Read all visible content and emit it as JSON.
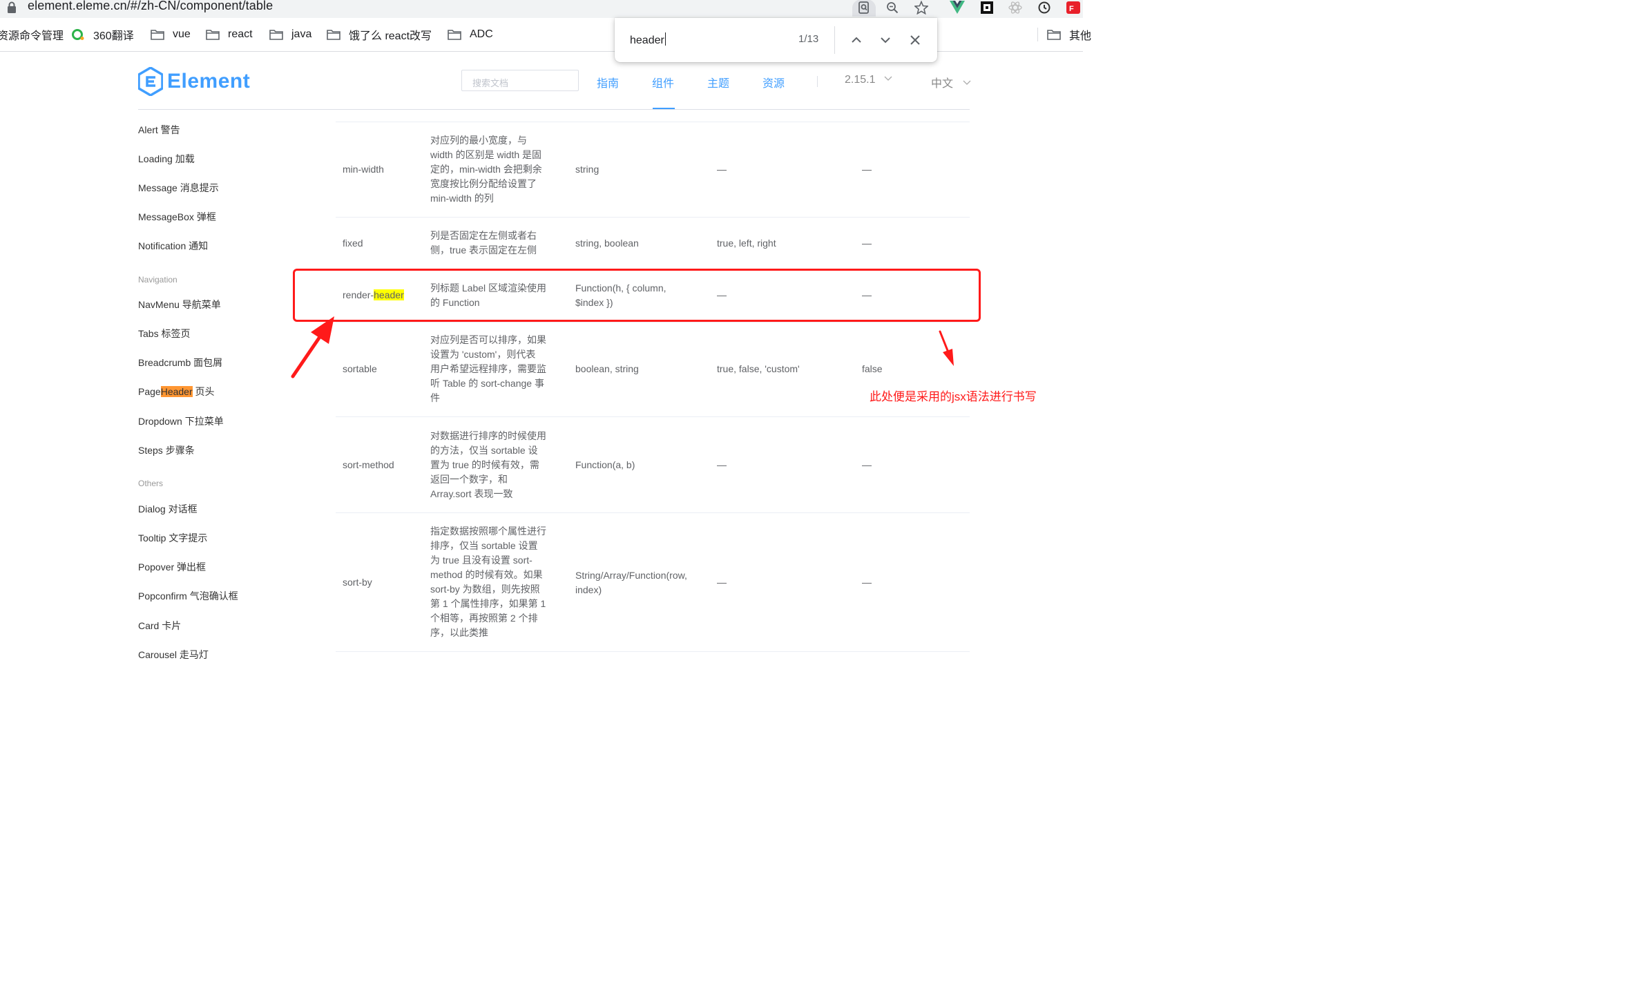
{
  "browser": {
    "url": "element.eleme.cn/#/zh-CN/component/table",
    "bookmarks": [
      "资源命令管理",
      "360翻译",
      "vue",
      "react",
      "java",
      "饿了么 react改写",
      "ADC",
      "其他"
    ],
    "find": {
      "query": "header",
      "count": "1/13"
    }
  },
  "site": {
    "logo": "Element",
    "search_placeholder": "搜索文档",
    "nav": [
      "指南",
      "组件",
      "主题",
      "资源"
    ],
    "active_nav": "组件",
    "version": "2.15.1",
    "language": "中文",
    "accent_color": "#409eff"
  },
  "sidebar": {
    "items_a": [
      "Alert 警告",
      "Loading 加载",
      "Message 消息提示",
      "MessageBox 弹框",
      "Notification 通知"
    ],
    "group_navigation": "Navigation",
    "items_b": [
      "NavMenu 导航菜单",
      "Tabs 标签页",
      "Breadcrumb 面包屑"
    ],
    "pageheader": {
      "pre": "Page",
      "hl": "Header",
      "post": " 页头"
    },
    "items_c": [
      "Dropdown 下拉菜单",
      "Steps 步骤条"
    ],
    "group_others": "Others",
    "items_d": [
      "Dialog 对话框",
      "Tooltip 文字提示",
      "Popover 弹出框",
      "Popconfirm 气泡确认框",
      "Card 卡片",
      "Carousel 走马灯"
    ]
  },
  "table": {
    "rows": [
      {
        "param": "min-width",
        "desc": [
          "对应列的最小宽度，与",
          "width 的区别是 width 是固",
          "定的，min-width 会把剩余",
          "宽度按比例分配给设置了",
          "min-width 的列"
        ],
        "type": [
          "string"
        ],
        "options": [
          "—"
        ],
        "default": "—"
      },
      {
        "param": "fixed",
        "desc": [
          "列是否固定在左侧或者右",
          "侧，true 表示固定在左侧"
        ],
        "type": [
          "string, boolean"
        ],
        "options": [
          "true, left, right"
        ],
        "default": "—"
      },
      {
        "param_pre": "render-",
        "param_hl": "header",
        "desc": [
          "列标题 Label 区域渲染使用",
          "的 Function"
        ],
        "type": [
          "Function(h, { column,",
          "$index })"
        ],
        "options": [
          "—"
        ],
        "default": "—"
      },
      {
        "param": "sortable",
        "desc": [
          "对应列是否可以排序，如果",
          "设置为 'custom'，则代表",
          "用户希望远程排序，需要监",
          "听 Table 的 sort-change 事",
          "件"
        ],
        "type": [
          "boolean, string"
        ],
        "options": [
          "true, false, 'custom'"
        ],
        "default": "false"
      },
      {
        "param": "sort-method",
        "desc": [
          "对数据进行排序的时候使用",
          "的方法，仅当 sortable 设",
          "置为 true 的时候有效，需",
          "返回一个数字，和",
          "Array.sort 表现一致"
        ],
        "type": [
          "Function(a, b)"
        ],
        "options": [
          "—"
        ],
        "default": "—"
      },
      {
        "param": "sort-by",
        "desc": [
          "指定数据按照哪个属性进行",
          "排序，仅当 sortable 设置",
          "为 true 且没有设置 sort-",
          "method 的时候有效。如果",
          "sort-by 为数组，则先按照",
          "第 1 个属性排序，如果第 1",
          "个相等，再按照第 2 个排",
          "序，以此类推"
        ],
        "type": [
          "String/Array/Function(row,",
          "index)"
        ],
        "options": [
          "—"
        ],
        "default": "—"
      }
    ]
  },
  "annotation": {
    "note": "此处便是采用的jsx语法进行书写",
    "color": "#ff1a1a"
  }
}
